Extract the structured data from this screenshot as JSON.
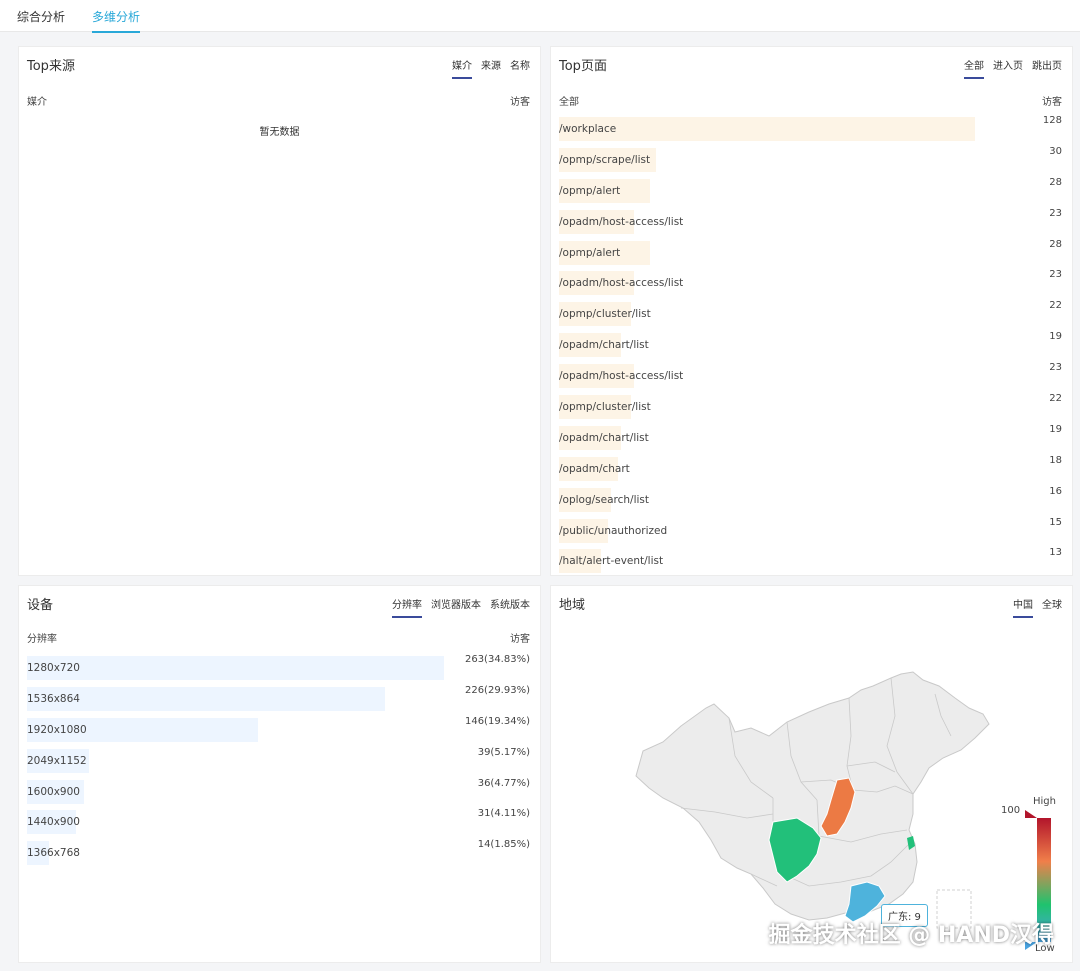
{
  "top_tabs": [
    {
      "label": "综合分析",
      "active": false
    },
    {
      "label": "多维分析",
      "active": true
    }
  ],
  "sources": {
    "title": "Top来源",
    "tabs": [
      {
        "label": "媒介",
        "active": true
      },
      {
        "label": "来源",
        "active": false
      },
      {
        "label": "名称",
        "active": false
      }
    ],
    "col_left": "媒介",
    "col_right": "访客",
    "empty_text": "暂无数据"
  },
  "pages": {
    "title": "Top页面",
    "tabs": [
      {
        "label": "全部",
        "active": true
      },
      {
        "label": "进入页",
        "active": false
      },
      {
        "label": "跳出页",
        "active": false
      }
    ],
    "col_left": "全部",
    "col_right": "访客",
    "bar_color": "#fdf4e6",
    "rows": [
      {
        "path": "/workplace",
        "value": "128",
        "ratio": 1.0
      },
      {
        "path": "/opmp/scrape/list",
        "value": "30",
        "ratio": 0.234
      },
      {
        "path": "/opmp/alert",
        "value": "28",
        "ratio": 0.219
      },
      {
        "path": "/opadm/host-access/list",
        "value": "23",
        "ratio": 0.18
      },
      {
        "path": "/opmp/alert",
        "value": "28",
        "ratio": 0.219
      },
      {
        "path": "/opadm/host-access/list",
        "value": "23",
        "ratio": 0.18
      },
      {
        "path": "/opmp/cluster/list",
        "value": "22",
        "ratio": 0.172
      },
      {
        "path": "/opadm/chart/list",
        "value": "19",
        "ratio": 0.148
      },
      {
        "path": "/opadm/host-access/list",
        "value": "23",
        "ratio": 0.18
      },
      {
        "path": "/opmp/cluster/list",
        "value": "22",
        "ratio": 0.172
      },
      {
        "path": "/opadm/chart/list",
        "value": "19",
        "ratio": 0.148
      },
      {
        "path": "/opadm/chart",
        "value": "18",
        "ratio": 0.141
      },
      {
        "path": "/oplog/search/list",
        "value": "16",
        "ratio": 0.125
      },
      {
        "path": "/public/unauthorized",
        "value": "15",
        "ratio": 0.117
      },
      {
        "path": "/halt/alert-event/list",
        "value": "13",
        "ratio": 0.102
      }
    ]
  },
  "devices": {
    "title": "设备",
    "tabs": [
      {
        "label": "分辨率",
        "active": true
      },
      {
        "label": "浏览器版本",
        "active": false
      },
      {
        "label": "系统版本",
        "active": false
      }
    ],
    "col_left": "分辨率",
    "col_right": "访客",
    "bar_color": "#edf5ff",
    "rows": [
      {
        "label": "1280x720",
        "value": "263(34.83%)",
        "ratio": 1.0
      },
      {
        "label": "1536x864",
        "value": "226(29.93%)",
        "ratio": 0.859
      },
      {
        "label": "1920x1080",
        "value": "146(19.34%)",
        "ratio": 0.555
      },
      {
        "label": "2049x1152",
        "value": "39(5.17%)",
        "ratio": 0.148
      },
      {
        "label": "1600x900",
        "value": "36(4.77%)",
        "ratio": 0.137
      },
      {
        "label": "1440x900",
        "value": "31(4.11%)",
        "ratio": 0.118
      },
      {
        "label": "1366x768",
        "value": "14(1.85%)",
        "ratio": 0.053
      }
    ]
  },
  "region": {
    "title": "地域",
    "tabs": [
      {
        "label": "中国",
        "active": true
      },
      {
        "label": "全球",
        "active": false
      }
    ],
    "legend_max": "100",
    "legend_high": "High",
    "legend_low": "Low",
    "tooltip": "广东: 9",
    "colors": {
      "base": "#ececec",
      "border": "#c9c9c9",
      "sichuan": "#22c07a",
      "shaanxi": "#ec7a44",
      "guangdong": "#4eb3dc",
      "zhejiang": "#22c07a"
    }
  },
  "watermark": "掘金技术社区 @ HAND汉得"
}
